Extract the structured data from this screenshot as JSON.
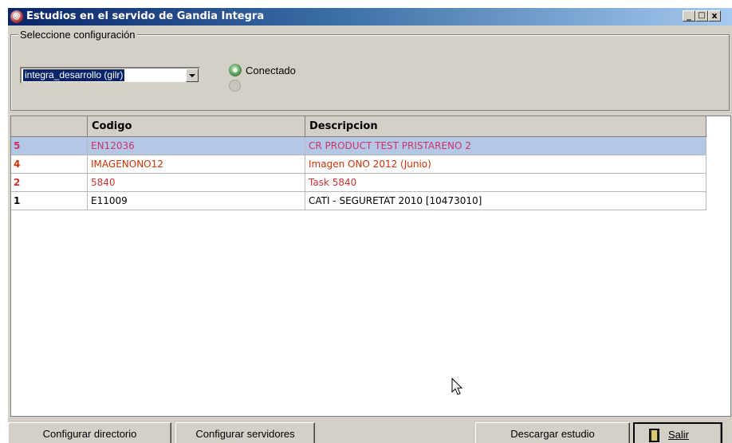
{
  "window": {
    "title": "Estudios en el servido de Gandia Integra",
    "controls": [
      "_",
      "□",
      "x"
    ]
  },
  "config": {
    "group_label": "Seleccione configuración",
    "selected": "integra_desarrollo (gilr)",
    "status_label": "Conectado",
    "status_icons": [
      "green-led-icon",
      "gray-led-icon"
    ]
  },
  "table": {
    "columns": [
      "",
      "Codigo",
      "Descripcion"
    ],
    "rows": [
      {
        "num": "5",
        "codigo": "EN12036",
        "descripcion": "CR PRODUCT TEST PRISTARENO 2",
        "color": "#cc3366",
        "selected": true
      },
      {
        "num": "4",
        "codigo": "IMAGENONO12",
        "descripcion": "Imagen ONO 2012 (Junio)",
        "color": "#cc3300",
        "selected": false
      },
      {
        "num": "2",
        "codigo": "5840",
        "descripcion": "Task 5840",
        "color": "#cc3333",
        "selected": false
      },
      {
        "num": "1",
        "codigo": "E11009",
        "descripcion": "CATI - SEGURETAT 2010 [10473010]",
        "color": "#000000",
        "selected": false
      }
    ],
    "selected_row_color": "#b4c8e6"
  },
  "buttons": {
    "configurar_directorio": "Configurar directorio",
    "configurar_servidores": "Configurar servidores",
    "descargar_estudio": "Descargar estudio",
    "salir": "Salir"
  }
}
